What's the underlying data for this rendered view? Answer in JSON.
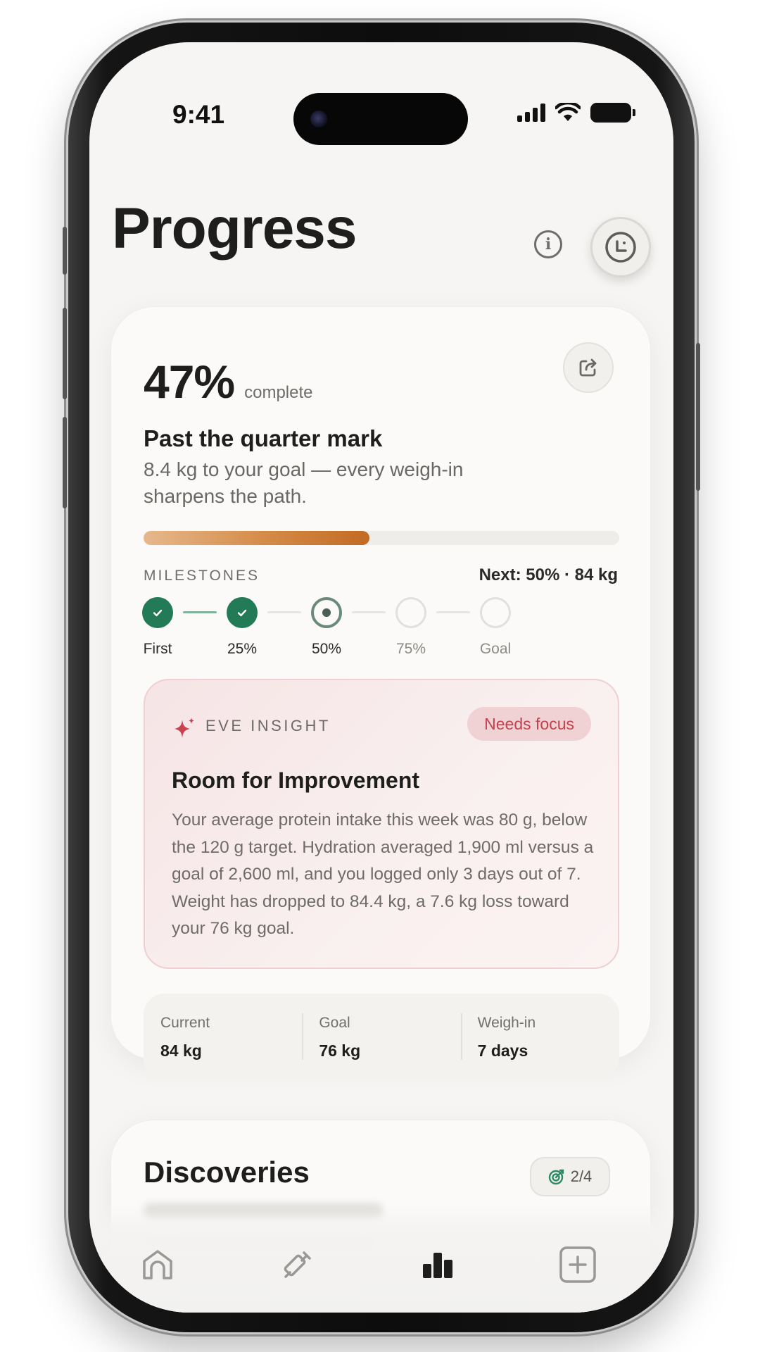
{
  "status_bar": {
    "time": "9:41"
  },
  "header": {
    "title": "Progress",
    "info_icon": "info-icon",
    "avatar_icon": "face-icon"
  },
  "progress": {
    "percent_label": "47%",
    "percent_value": 0.47,
    "complete_label": "complete",
    "headline": "Past the quarter mark",
    "subtext": "8.4 kg to your goal — every weigh-in sharpens the path.",
    "bar_fill": 0.475
  },
  "milestones": {
    "label": "MILESTONES",
    "next": "Next: 50% · 84 kg",
    "items": [
      {
        "label": "First",
        "state": "done"
      },
      {
        "label": "25%",
        "state": "done"
      },
      {
        "label": "50%",
        "state": "current"
      },
      {
        "label": "75%",
        "state": "todo"
      },
      {
        "label": "Goal",
        "state": "todo"
      }
    ]
  },
  "insight": {
    "label": "EVE INSIGHT",
    "badge": "Needs focus",
    "title": "Room for Improvement",
    "body": "Your average protein intake this week was 80 g, below the 120 g target. Hydration averaged 1,900 ml versus a goal of 2,600 ml, and you logged only 3 days out of 7. Weight has dropped to 84.4 kg, a 7.6 kg loss toward your 76 kg goal."
  },
  "stats": [
    {
      "label": "Current",
      "value": "84 kg"
    },
    {
      "label": "Goal",
      "value": "76 kg"
    },
    {
      "label": "Weigh-in",
      "value": "7 days"
    }
  ],
  "discoveries": {
    "title": "Discoveries",
    "count": "2/4"
  },
  "nav": {
    "items": [
      "home-icon",
      "syringe-icon",
      "chart-bar-icon",
      "plus-square-icon"
    ],
    "active": 2
  },
  "colors": {
    "accent_orange": "#c26a24",
    "milestone_green": "#237a57",
    "insight_red": "#c2434f",
    "background": "#f6f5f3"
  }
}
